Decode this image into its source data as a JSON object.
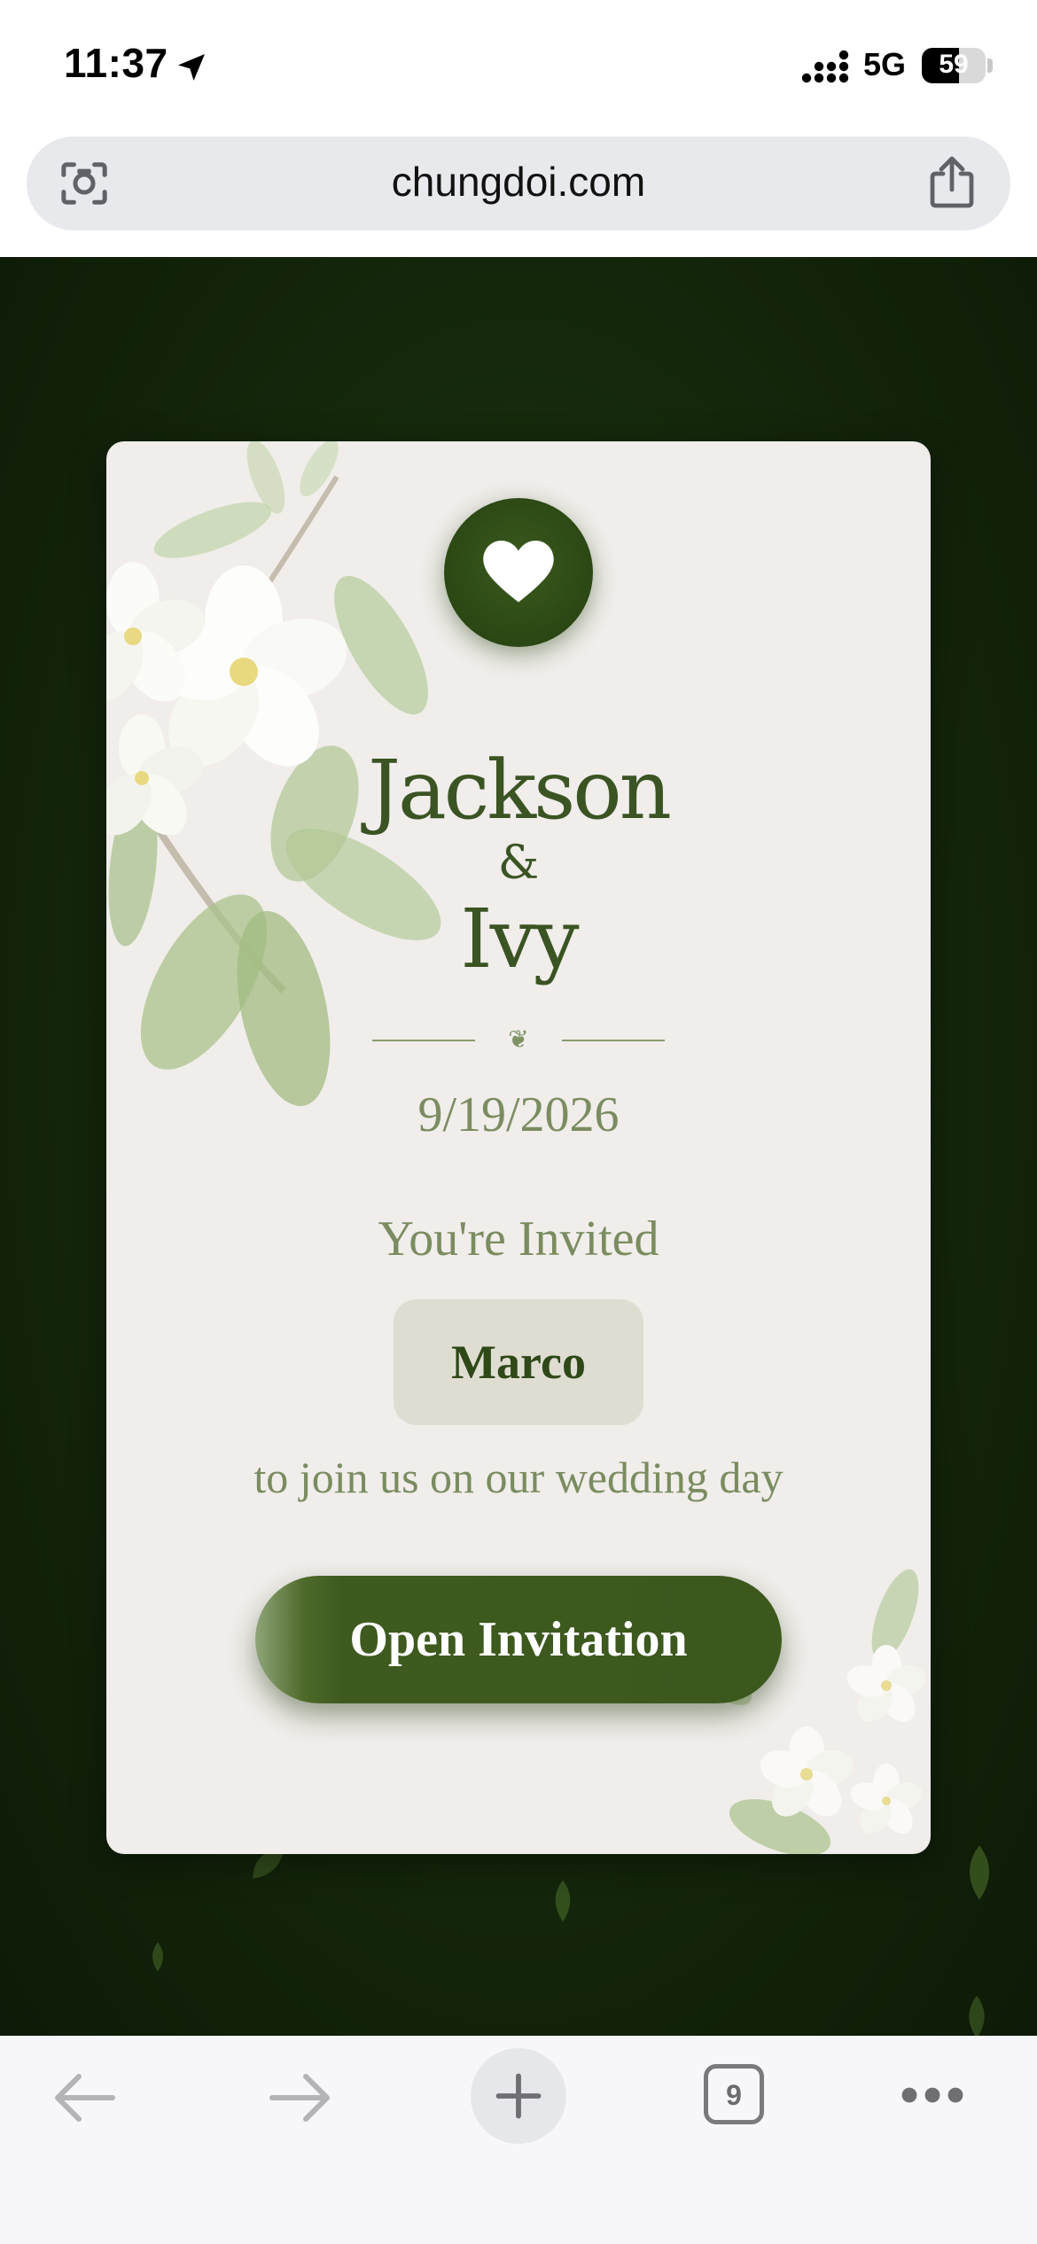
{
  "status_bar": {
    "time": "11:37",
    "network": "5G",
    "battery": "59",
    "battery_level": 0.59
  },
  "browser": {
    "url": "chungdoi.com",
    "open_tabs": "9"
  },
  "invitation": {
    "partner1": "Jackson",
    "ampersand": "&",
    "partner2": "Ivy",
    "ornament": "❦",
    "date": "9/19/2026",
    "invited_text": "You're Invited",
    "guest_name": "Marco",
    "join_text": "to join us on our wedding day",
    "open_button": "Open Invitation"
  },
  "colors": {
    "background": "#162a0c",
    "card": "#f0edea",
    "accent": "#3a5423",
    "muted_text": "#7a8c60"
  },
  "icons": [
    "location-arrow-icon",
    "signal-icon",
    "lens-icon",
    "share-icon",
    "heart-icon",
    "back-arrow-icon",
    "forward-arrow-icon",
    "plus-icon",
    "tabs-icon",
    "more-icon"
  ]
}
